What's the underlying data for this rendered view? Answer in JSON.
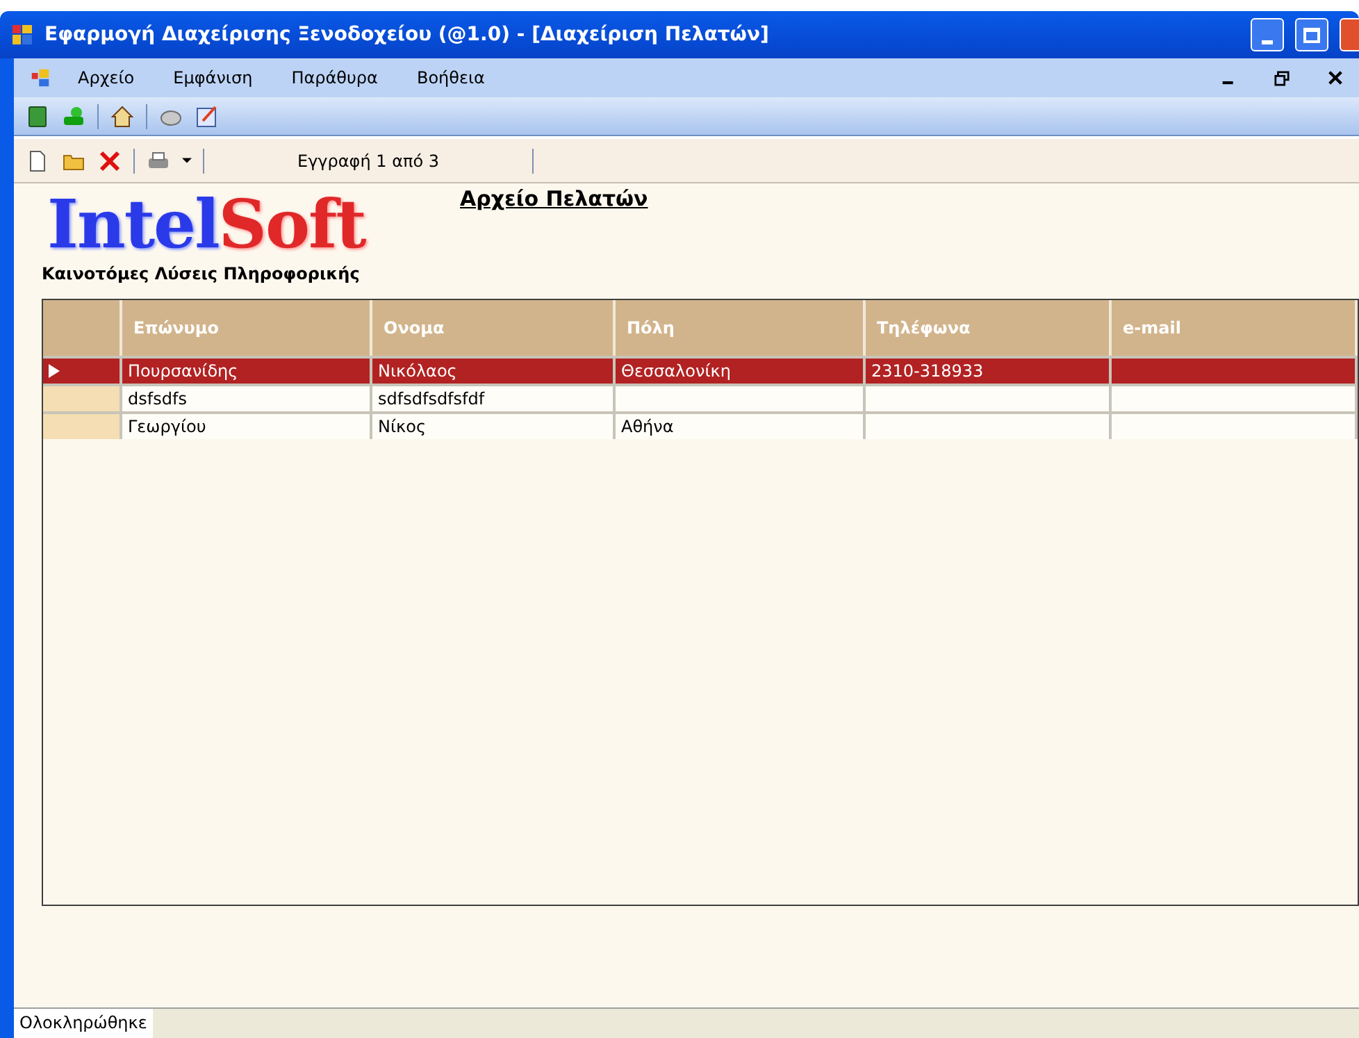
{
  "window": {
    "title": "Εφαρμογή Διαχείρισης Ξενοδοχείου (@1.0) - [Διαχείριση Πελατών]"
  },
  "menu": [
    "Αρχείο",
    "Εμφάνιση",
    "Παράθυρα",
    "Βοήθεια"
  ],
  "toolbar2": {
    "record": "Εγγραφή 1 από 3"
  },
  "logo": {
    "part1": "Intel",
    "part2": "Soft",
    "tagline": "Καινοτόμες Λύσεις Πληροφορικής"
  },
  "heading": "Αρχείο Πελατών",
  "table": {
    "columns": [
      "Επώνυμο",
      "Ονομα",
      "Πόλη",
      "Τηλέφωνα",
      "e-mail"
    ],
    "rows": [
      {
        "selected": true,
        "cells": [
          "Πουρσανίδης",
          "Νικόλαος",
          "Θεσσαλονίκη",
          "2310-318933",
          ""
        ]
      },
      {
        "selected": false,
        "cells": [
          "dsfsdfs",
          "sdfsdfsdfsfdf",
          "",
          "",
          ""
        ]
      },
      {
        "selected": false,
        "cells": [
          "Γεωργίου",
          "Νίκος",
          "Αθήνα",
          "",
          ""
        ]
      }
    ]
  },
  "status_bar": "Ολοκληρώθηκε"
}
